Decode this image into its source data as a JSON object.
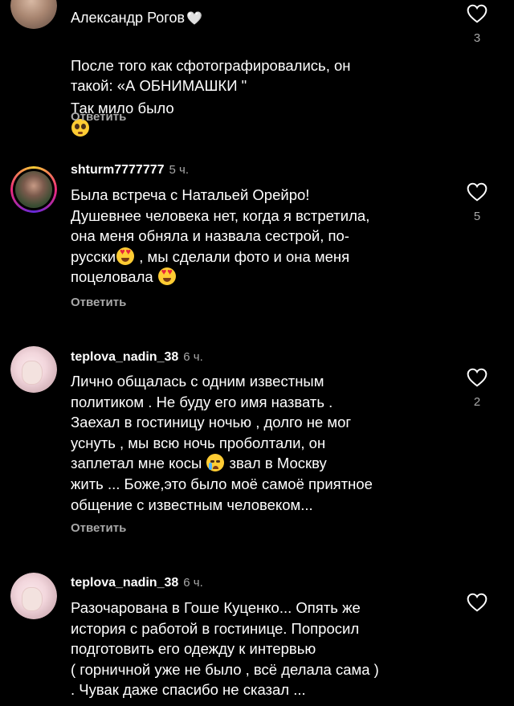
{
  "comments": [
    {
      "username": "Александр Рогов",
      "time": "",
      "text": "После того как сфотографировались, он\nтакой: «А ОБНИМАШКИ \"",
      "text2": "Так мило было",
      "reply": "Ответить",
      "likes": "3"
    },
    {
      "username": "shturm7777777",
      "time": "5 ч.",
      "text_a": "Была встреча с Натальей Орейро!\nДушевнее человека нет, когда я встретила,\nона меня обняла и назвала сестрой, по-\nрусски",
      "text_b": " , мы сделали фото и она меня",
      "text_c": "\nпоцеловала ",
      "reply": "Ответить",
      "likes": "5"
    },
    {
      "username": "teplova_nadin_38",
      "time": "6 ч.",
      "text_a": "Лично общалась с одним известным\nполитиком . Не буду его имя назвать .\nЗаехал в гостиницу ночью , долго не мог\nуснуть , мы всю ночь проболтали, он\nзаплетал мне косы ",
      "text_b": " звал в Москву\nжить ... Боже,это было моё самоё приятное\nобщение с известным человеком...",
      "reply": "Ответить",
      "likes": "2"
    },
    {
      "username": "teplova_nadin_38",
      "time": "6 ч.",
      "text": "Разочарована в Гоше Куценко... Опять же\nистория с работой в гостинице. Попросил\nподготовить его одежду к интервью\n( горничной уже не было , всё делала сама )\n. Чувак даже спасибо не сказал ..."
    }
  ],
  "icons": {
    "like": "heart-outline-icon",
    "emoji_pleading": "pleading-face-icon",
    "emoji_heart_eyes": "heart-eyes-face-icon",
    "emoji_cry": "crying-face-icon",
    "white_heart": "white-heart-icon"
  },
  "colors": {
    "background": "#000000",
    "text": "#ffffff",
    "secondary": "#a8a8a8"
  }
}
